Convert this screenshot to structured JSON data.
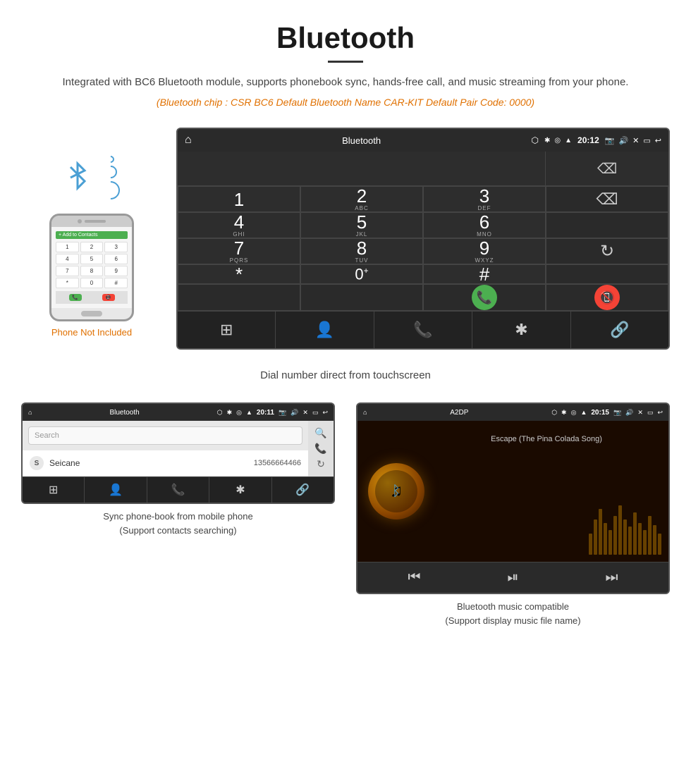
{
  "page": {
    "title": "Bluetooth",
    "description": "Integrated with BC6 Bluetooth module, supports phonebook sync, hands-free call, and music streaming from your phone.",
    "specs": "(Bluetooth chip : CSR BC6    Default Bluetooth Name CAR-KIT    Default Pair Code: 0000)",
    "caption_main": "Dial number direct from touchscreen",
    "caption_contacts": "Sync phone-book from mobile phone\n(Support contacts searching)",
    "caption_music": "Bluetooth music compatible\n(Support display music file name)"
  },
  "large_screen": {
    "title": "Bluetooth",
    "time": "20:12",
    "dialpad": {
      "keys": [
        {
          "num": "1",
          "sub": ""
        },
        {
          "num": "2",
          "sub": "ABC"
        },
        {
          "num": "3",
          "sub": "DEF"
        },
        {
          "num": "4",
          "sub": "GHI"
        },
        {
          "num": "5",
          "sub": "JKL"
        },
        {
          "num": "6",
          "sub": "MNO"
        },
        {
          "num": "7",
          "sub": "PQRS"
        },
        {
          "num": "8",
          "sub": "TUV"
        },
        {
          "num": "9",
          "sub": "WXYZ"
        },
        {
          "num": "*",
          "sub": ""
        },
        {
          "num": "0",
          "sub": "+"
        },
        {
          "num": "#",
          "sub": ""
        }
      ]
    },
    "bottom_nav": [
      "⊞",
      "👤",
      "📞",
      "✱",
      "🔗"
    ]
  },
  "contacts_screen": {
    "title": "Bluetooth",
    "time": "20:11",
    "search_placeholder": "Search",
    "contacts": [
      {
        "letter": "S",
        "name": "Seicane",
        "number": "13566664466"
      }
    ]
  },
  "music_screen": {
    "title": "A2DP",
    "time": "20:15",
    "song_title": "Escape (The Pina Colada Song)",
    "eq_bars": [
      30,
      50,
      70,
      55,
      40,
      65,
      80,
      60,
      45,
      70,
      55,
      40,
      65,
      50,
      35
    ]
  },
  "phone": {
    "not_included": "Phone Not Included"
  },
  "icons": {
    "bluetooth": "ᛒ",
    "home": "⌂",
    "back": "↩",
    "usb": "⬡",
    "camera": "📷",
    "volume": "🔊",
    "close": "✕",
    "minimize": "▭",
    "search": "🔍",
    "phone_call": "📞",
    "reload": "↻",
    "backspace": "⌫",
    "grid": "⊞",
    "person": "👤",
    "link": "🔗",
    "skip_prev": "⏮",
    "play_pause": "⏯",
    "skip_next": "⏭"
  }
}
